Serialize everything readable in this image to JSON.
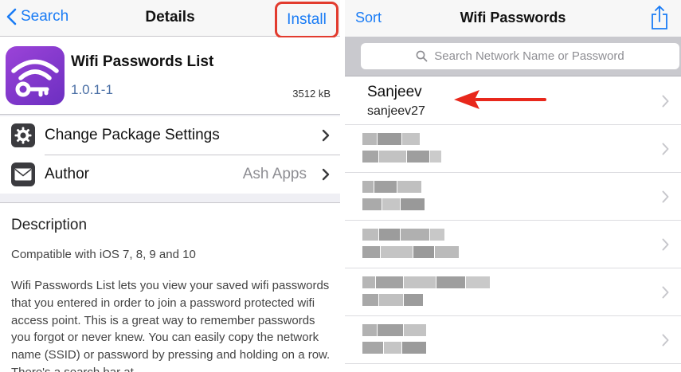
{
  "left": {
    "nav": {
      "back_label": "Search",
      "title": "Details",
      "install_label": "Install"
    },
    "package": {
      "name": "Wifi Passwords List",
      "version": "1.0.1-1",
      "size": "3512 kB"
    },
    "rows": [
      {
        "label": "Change Package Settings",
        "value": "",
        "icon": "gear-icon"
      },
      {
        "label": "Author",
        "value": "Ash Apps",
        "icon": "mail-icon"
      }
    ],
    "description": {
      "title": "Description",
      "compat": "Compatible with iOS 7, 8, 9 and 10",
      "body": "Wifi Passwords List lets you view your saved wifi passwords that you entered in order to join a password protected wifi access point. This is a great way to remember passwords you forgot or never knew. You can easily copy the network name (SSID) or password by pressing and holding on a row. There's a search bar at"
    },
    "highlight_color": "#e23b2e",
    "accent_color": "#1a7cf5"
  },
  "right": {
    "nav": {
      "sort_label": "Sort",
      "title": "Wifi Passwords",
      "share_icon": "share-icon"
    },
    "search": {
      "placeholder": "Search Network Name or Password"
    },
    "networks": [
      {
        "ssid": "Sanjeev",
        "password": "sanjeev27",
        "blurred": false
      },
      {
        "ssid": "",
        "password": "",
        "blurred": true
      },
      {
        "ssid": "",
        "password": "",
        "blurred": true
      },
      {
        "ssid": "",
        "password": "",
        "blurred": true
      },
      {
        "ssid": "",
        "password": "",
        "blurred": true
      },
      {
        "ssid": "",
        "password": "",
        "blurred": true
      }
    ],
    "annotation_arrow_color": "#e8281c"
  }
}
